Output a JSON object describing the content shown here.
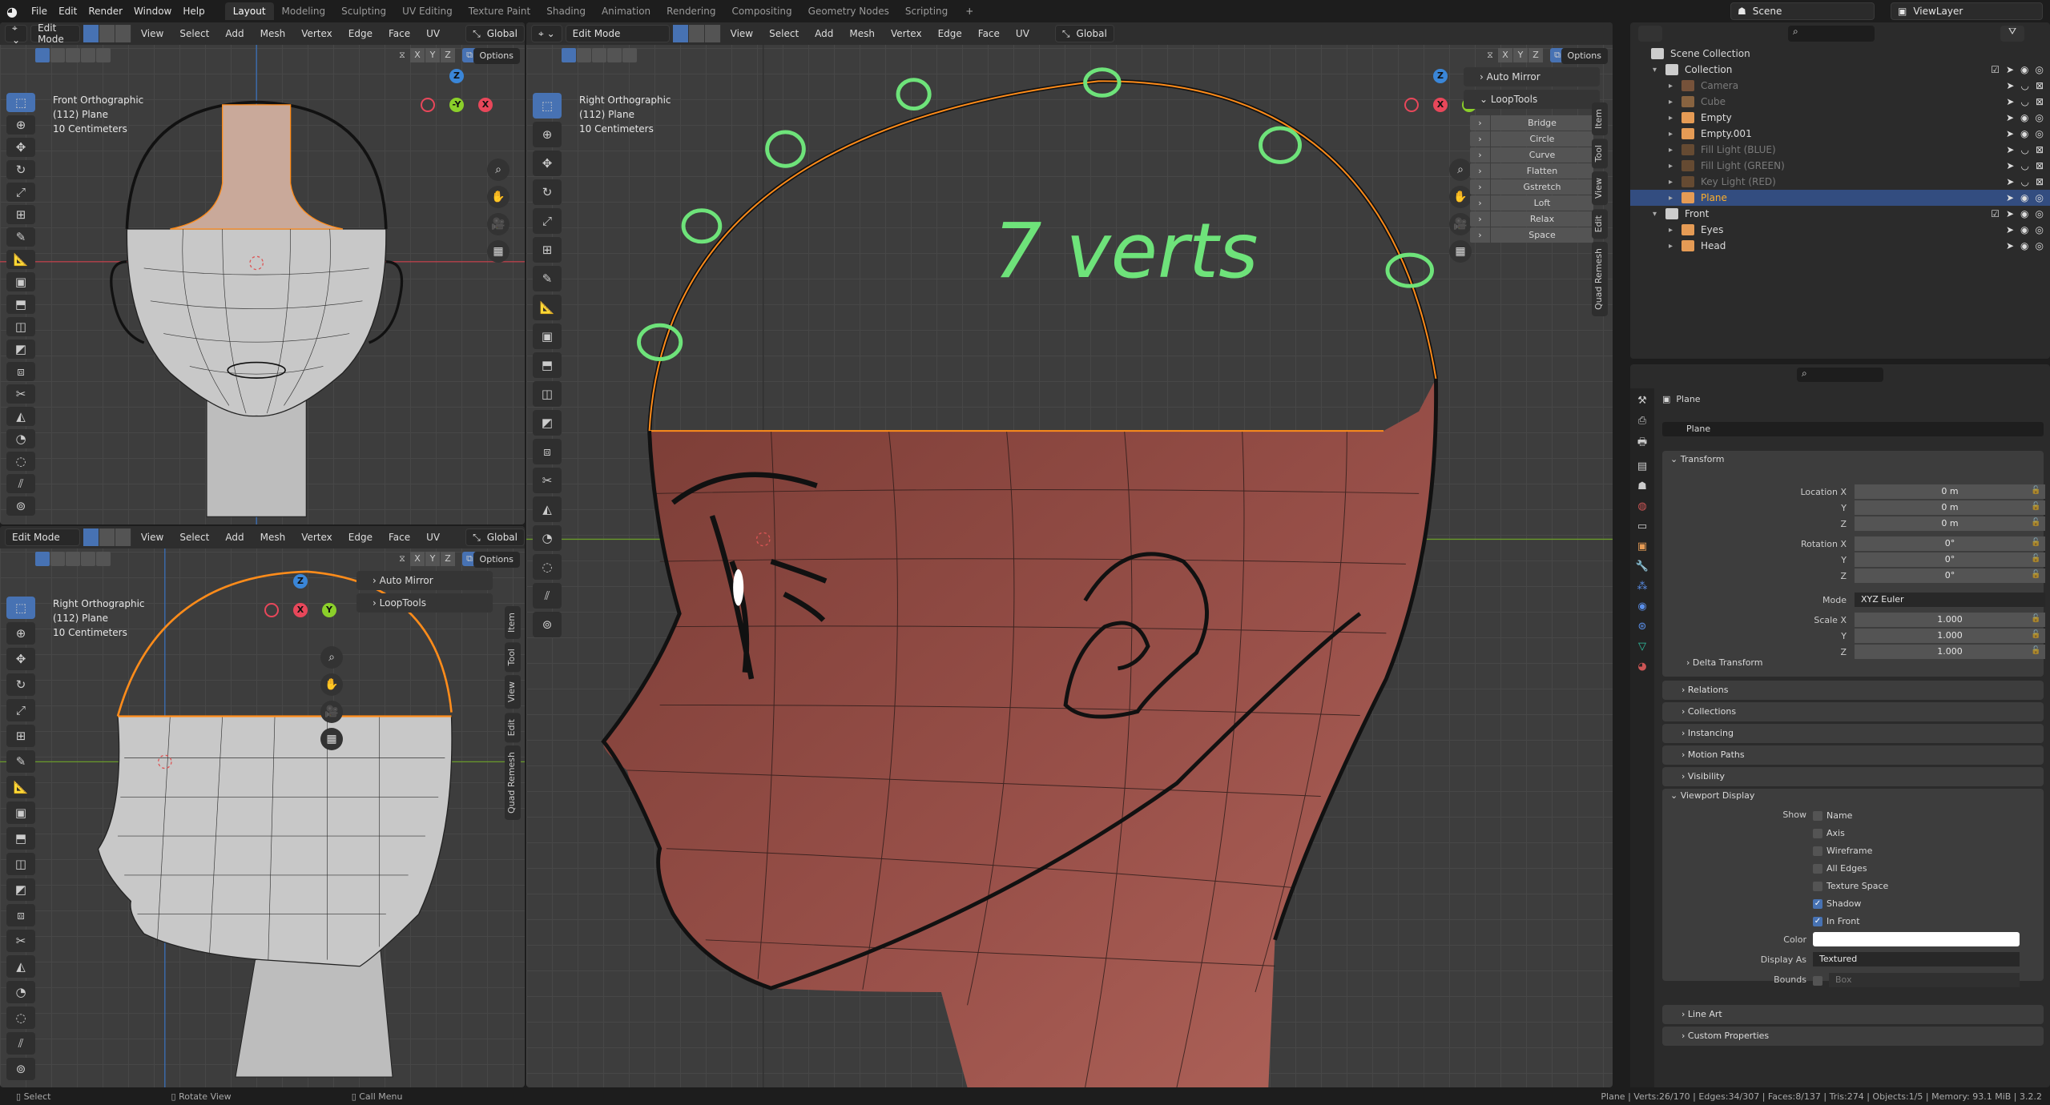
{
  "app": {
    "logo": "blender-logo-icon"
  },
  "menubar": {
    "items": [
      "File",
      "Edit",
      "Render",
      "Window",
      "Help"
    ]
  },
  "workspaces": {
    "tabs": [
      "Layout",
      "Modeling",
      "Sculpting",
      "UV Editing",
      "Texture Paint",
      "Shading",
      "Animation",
      "Rendering",
      "Compositing",
      "Geometry Nodes",
      "Scripting"
    ],
    "active": "Layout",
    "add_label": "+"
  },
  "scene": {
    "label": "Scene",
    "view_layer": "ViewLayer"
  },
  "viewports": [
    {
      "mode": "Edit Mode",
      "menus": [
        "View",
        "Select",
        "Add",
        "Mesh",
        "Vertex",
        "Edge",
        "Face",
        "UV"
      ],
      "orientation": "Global",
      "overlay": [
        "Front Orthographic",
        "(112) Plane",
        "10 Centimeters"
      ],
      "axes": [
        "X",
        "Y",
        "Z"
      ],
      "options": "Options",
      "gizmo": [
        "Z",
        "-Y",
        "X"
      ]
    },
    {
      "mode": "Edit Mode",
      "menus": [
        "View",
        "Select",
        "Add",
        "Mesh",
        "Vertex",
        "Edge",
        "Face",
        "UV"
      ],
      "orientation": "Global",
      "overlay": [
        "Right Orthographic",
        "(112) Plane",
        "10 Centimeters"
      ],
      "axes": [
        "X",
        "Y",
        "Z"
      ],
      "options": "Options",
      "gizmo": [
        "Z",
        "X",
        "Y"
      ],
      "panels": [
        "Auto Mirror",
        "LoopTools"
      ],
      "tabs": [
        "Item",
        "Tool",
        "View",
        "Edit",
        "Quad Remesh"
      ]
    },
    {
      "mode": "Edit Mode",
      "menus": [
        "View",
        "Select",
        "Add",
        "Mesh",
        "Vertex",
        "Edge",
        "Face",
        "UV"
      ],
      "orientation": "Global",
      "overlay": [
        "Right Orthographic",
        "(112) Plane",
        "10 Centimeters"
      ],
      "axes": [
        "X",
        "Y",
        "Z"
      ],
      "options": "Options",
      "gizmo": [
        "Z",
        "X",
        "Y"
      ],
      "panels": [
        "Auto Mirror",
        "LoopTools"
      ],
      "tabs": [
        "Item",
        "Tool",
        "View",
        "Edit",
        "Quad Remesh"
      ],
      "looptools": [
        "Bridge",
        "Circle",
        "Curve",
        "Flatten",
        "Gstretch",
        "Loft",
        "Relax",
        "Space"
      ]
    }
  ],
  "annotation": {
    "text": "7 verts",
    "color": "#6ee37a"
  },
  "outliner": {
    "root": "Scene Collection",
    "rows": [
      {
        "name": "Collection",
        "type": "collection",
        "depth": 1,
        "dim": false
      },
      {
        "name": "Camera",
        "type": "camera",
        "depth": 2,
        "dim": true
      },
      {
        "name": "Cube",
        "type": "mesh",
        "depth": 2,
        "dim": true
      },
      {
        "name": "Empty",
        "type": "empty",
        "depth": 2,
        "dim": false
      },
      {
        "name": "Empty.001",
        "type": "empty",
        "depth": 2,
        "dim": false
      },
      {
        "name": "Fill Light (BLUE)",
        "type": "light",
        "depth": 2,
        "dim": true
      },
      {
        "name": "Fill Light (GREEN)",
        "type": "light",
        "depth": 2,
        "dim": true
      },
      {
        "name": "Key Light (RED)",
        "type": "light",
        "depth": 2,
        "dim": true
      },
      {
        "name": "Plane",
        "type": "mesh",
        "depth": 2,
        "dim": false,
        "selected": true
      },
      {
        "name": "Front",
        "type": "collection",
        "depth": 1,
        "dim": false
      },
      {
        "name": "Eyes",
        "type": "empty",
        "depth": 2,
        "dim": false
      },
      {
        "name": "Head",
        "type": "empty",
        "depth": 2,
        "dim": false
      }
    ]
  },
  "properties": {
    "object_name": "Plane",
    "datablock": "Plane",
    "transform": {
      "title": "Transform",
      "location_label": "Location X",
      "location": [
        "0 m",
        "0 m",
        "0 m"
      ],
      "rotation_label": "Rotation X",
      "rotation": [
        "0°",
        "0°",
        "0°"
      ],
      "mode_label": "Mode",
      "mode": "XYZ Euler",
      "scale_label": "Scale X",
      "scale": [
        "1.000",
        "1.000",
        "1.000"
      ],
      "y": "Y",
      "z": "Z",
      "delta": "Delta Transform"
    },
    "collapsed_panels": [
      "Relations",
      "Collections",
      "Instancing",
      "Motion Paths",
      "Visibility"
    ],
    "viewport_display": {
      "title": "Viewport Display",
      "show_label": "Show",
      "options": [
        {
          "label": "Name",
          "checked": false
        },
        {
          "label": "Axis",
          "checked": false
        },
        {
          "label": "Wireframe",
          "checked": false
        },
        {
          "label": "All Edges",
          "checked": false
        },
        {
          "label": "Texture Space",
          "checked": false
        },
        {
          "label": "Shadow",
          "checked": true
        },
        {
          "label": "In Front",
          "checked": true
        }
      ],
      "color_label": "Color",
      "color": "#ffffff",
      "display_as_label": "Display As",
      "display_as": "Textured",
      "bounds_label": "Bounds",
      "bounds": "Box"
    },
    "bottom_panels": [
      "Line Art",
      "Custom Properties"
    ]
  },
  "statusbar": {
    "hints": [
      "Select",
      "Rotate View",
      "Call Menu"
    ],
    "info": "Plane | Verts:26/170 | Edges:34/307 | Faces:8/137 | Tris:274 | Objects:1/5 | Memory: 93.1 MiB | 3.2.2"
  },
  "colors": {
    "accent": "#4772b3",
    "selection": "#ff8c1a",
    "face_skin": "#8e4a42",
    "x_axis": "#e8475a",
    "y_axis": "#8bcf2a",
    "z_axis": "#3a86d8"
  }
}
